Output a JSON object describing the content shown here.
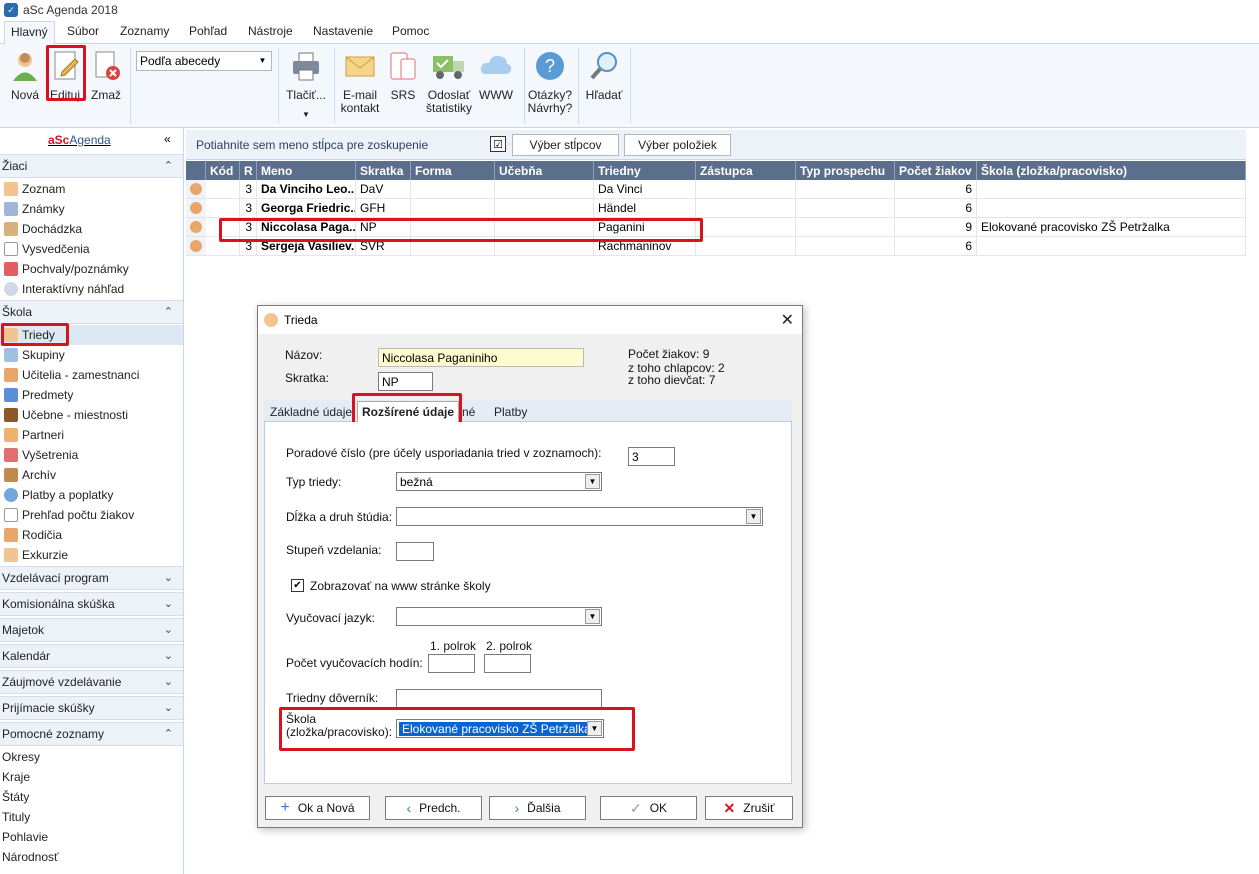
{
  "app": {
    "title": "aSc Agenda 2018"
  },
  "menu": [
    "Hlavný",
    "Súbor",
    "Zoznamy",
    "Pohľad",
    "Nástroje",
    "Nastavenie",
    "Pomoc"
  ],
  "ribbon": {
    "nova": "Nová",
    "edituj": "Edituj",
    "zmaz": "Zmaž",
    "sort_select": "Podľa abecedy",
    "print": "Tlačiť...",
    "email_1": "E-mail",
    "email_2": "kontakt",
    "srs": "SRS",
    "stats_1": "Odoslať",
    "stats_2": "štatistiky",
    "www": "WWW",
    "help_1": "Otázky?",
    "help_2": "Návrhy?",
    "search": "Hľadať"
  },
  "sidebar": {
    "brand_a": "aSc",
    "brand_b": "Agenda",
    "groups": {
      "ziaci": "Žiaci",
      "skola": "Škola",
      "vzdel": "Vzdelávací program",
      "komis": "Komisionálna skúška",
      "majetok": "Majetok",
      "kalendar": "Kalendár",
      "zaujmove": "Záujmové vzdelávanie",
      "prijimacie": "Prijímacie skúšky",
      "pomocne": "Pomocné zoznamy"
    },
    "ziaci_items": [
      "Zoznam",
      "Známky",
      "Dochádzka",
      "Vysvedčenia",
      "Pochvaly/poznámky",
      "Interaktívny náhľad"
    ],
    "skola_items": [
      "Triedy",
      "Skupiny",
      "Učitelia - zamestnanci",
      "Predmety",
      "Učebne - miestnosti",
      "Partneri",
      "Vyšetrenia",
      "Archív",
      "Platby a poplatky",
      "Prehľad počtu žiakov",
      "Rodičia",
      "Exkurzie"
    ],
    "pomocne_items": [
      "Okresy",
      "Kraje",
      "Štáty",
      "Tituly",
      "Pohlavie",
      "Národnosť"
    ]
  },
  "grid": {
    "group_hint": "Potiahnite sem meno stĺpca pre zoskupenie",
    "btn_columns": "Výber stĺpcov",
    "btn_items": "Výber položiek",
    "headers": [
      "Kód",
      "R",
      "Meno",
      "Skratka",
      "Forma",
      "Učebňa",
      "Triedny",
      "Zástupca",
      "Typ prospechu",
      "Počet žiakov",
      "Škola (zložka/pracovisko)"
    ],
    "rows": [
      {
        "r": "3",
        "meno": "Da Vinciho Leo...",
        "skratka": "DaV",
        "triedny": "Da Vinci",
        "pocet": "6",
        "skola": ""
      },
      {
        "r": "3",
        "meno": "Georga Friedric...",
        "skratka": "GFH",
        "triedny": "Händel",
        "pocet": "6",
        "skola": ""
      },
      {
        "r": "3",
        "meno": "Niccolasa Paga...",
        "skratka": "NP",
        "triedny": "Paganini",
        "pocet": "9",
        "skola": "Elokované pracovisko ZŠ Petržalka"
      },
      {
        "r": "3",
        "meno": "Sergeja Vasiliev...",
        "skratka": "SVR",
        "triedny": "Rachmaninov",
        "pocet": "6",
        "skola": ""
      }
    ]
  },
  "dialog": {
    "title": "Trieda",
    "nazov_label": "Názov:",
    "nazov_value": "Niccolasa Paganiniho",
    "skratka_label": "Skratka:",
    "skratka_value": "NP",
    "pocet": "Počet žiakov: 9",
    "chlapcov": "z toho chlapcov: 2",
    "dievcat": "z toho dievčat: 7",
    "tabs": [
      "Základné údaje",
      "Rozšírené údaje",
      "né",
      "Platby"
    ],
    "poradove_label": "Poradové číslo (pre účely usporiadania tried v zoznamoch):",
    "poradove_value": "3",
    "typ_label": "Typ triedy:",
    "typ_value": "bežná",
    "dlzka_label": "Dĺžka a druh štúdia:",
    "stupen_label": "Stupeň vzdelania:",
    "www_label": "Zobrazovať na www stránke školy",
    "jazyk_label": "Vyučovací jazyk:",
    "polrok1": "1. polrok",
    "polrok2": "2. polrok",
    "hodiny_label": "Počet vyučovacích hodín:",
    "doverník_label": "Triedny dôverník:",
    "skola_label_1": "Škola",
    "skola_label_2": "(zložka/pracovisko):",
    "skola_value": "Elokované pracovisko ZŠ Petržalka",
    "btn_ok_nova": "Ok a Nová",
    "btn_predch": "Predch.",
    "btn_dalsia": "Ďalšia",
    "btn_ok": "OK",
    "btn_zrusit": "Zrušiť"
  }
}
